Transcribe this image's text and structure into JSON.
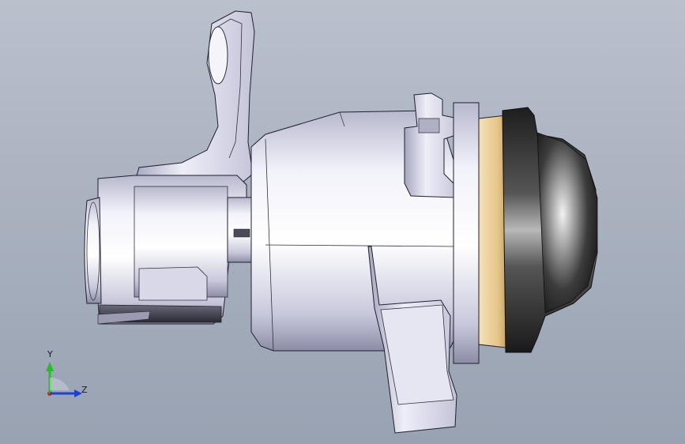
{
  "viewport": {
    "background_top": "#b9c1cd",
    "background_bottom": "#98a2b2"
  },
  "model": {
    "body_color": "#dcdcee",
    "shade_color": "#8f8fa8",
    "brass_color": "#e8c88e",
    "rubber_color": "#3c3c3c"
  },
  "triad": {
    "y_label": "Y",
    "z_label": "Z",
    "y_color": "#22c022",
    "z_color": "#2040d0",
    "x_color": "#d02020"
  }
}
